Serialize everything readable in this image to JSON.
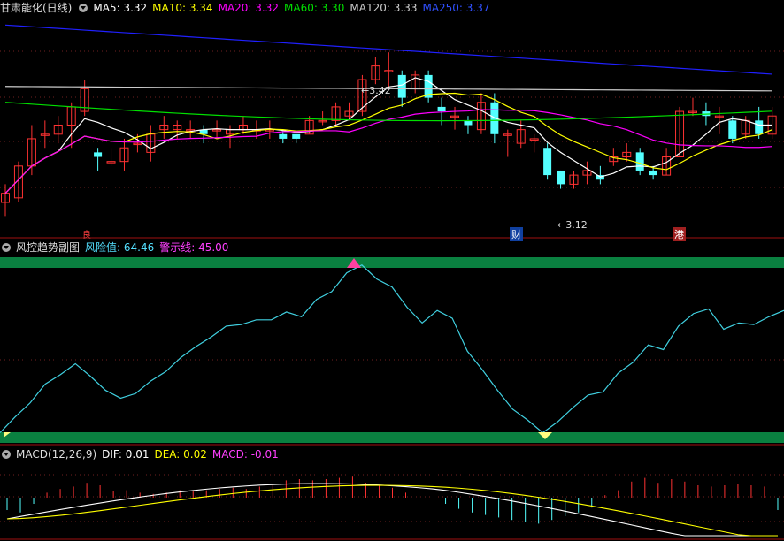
{
  "main_header": {
    "title": "甘肃能化(日线)",
    "ma5": "MA5: 3.32",
    "ma10": "MA10: 3.34",
    "ma20": "MA20: 3.32",
    "ma60": "MA60: 3.30",
    "ma120": "MA120: 3.33",
    "ma250": "MA250: 3.37"
  },
  "annotations": {
    "high": "3.42",
    "low": "3.12",
    "mark_left": "良",
    "mark_cai": "财",
    "mark_gang": "港"
  },
  "risk_header": {
    "title": "风控趋势副图",
    "risk_value": "风险值: 64.46",
    "warn_line": "警示线: 45.00"
  },
  "macd_header": {
    "title": "MACD(12,26,9)",
    "dif": "DIF: 0.01",
    "dea": "DEA: 0.02",
    "macd": "MACD: -0.01"
  },
  "colors": {
    "up": "#ff3232",
    "down": "#54ffff",
    "ma5": "#ffffff",
    "ma10": "#ffff00",
    "ma20": "#ff00ff",
    "ma60": "#00e000",
    "ma120": "#cccccc",
    "ma250": "#2020ff",
    "risk_line": "#40d0e0",
    "band": "#0a8040"
  },
  "chart_data": [
    {
      "type": "candlestick",
      "title": "甘肃能化(日线)",
      "ylim": [
        3.02,
        3.5
      ],
      "candles": [
        [
          3.09,
          3.11,
          3.13,
          3.06
        ],
        [
          3.1,
          3.17,
          3.18,
          3.09
        ],
        [
          3.17,
          3.23,
          3.26,
          3.15
        ],
        [
          3.24,
          3.24,
          3.27,
          3.21
        ],
        [
          3.24,
          3.26,
          3.28,
          3.22
        ],
        [
          3.26,
          3.3,
          3.31,
          3.21
        ],
        [
          3.29,
          3.34,
          3.36,
          3.28
        ],
        [
          3.2,
          3.19,
          3.21,
          3.16
        ],
        [
          3.18,
          3.18,
          3.21,
          3.17
        ],
        [
          3.18,
          3.21,
          3.23,
          3.16
        ],
        [
          3.22,
          3.22,
          3.24,
          3.2
        ],
        [
          3.2,
          3.24,
          3.26,
          3.18
        ],
        [
          3.25,
          3.26,
          3.28,
          3.23
        ],
        [
          3.25,
          3.26,
          3.27,
          3.23
        ],
        [
          3.25,
          3.25,
          3.27,
          3.23
        ],
        [
          3.25,
          3.24,
          3.26,
          3.22
        ],
        [
          3.25,
          3.25,
          3.27,
          3.23
        ],
        [
          3.24,
          3.25,
          3.26,
          3.21
        ],
        [
          3.25,
          3.26,
          3.28,
          3.24
        ],
        [
          3.25,
          3.25,
          3.27,
          3.23
        ],
        [
          3.25,
          3.25,
          3.27,
          3.23
        ],
        [
          3.24,
          3.23,
          3.25,
          3.22
        ],
        [
          3.24,
          3.23,
          3.24,
          3.22
        ],
        [
          3.24,
          3.27,
          3.28,
          3.24
        ],
        [
          3.27,
          3.27,
          3.29,
          3.26
        ],
        [
          3.27,
          3.3,
          3.31,
          3.26
        ],
        [
          3.28,
          3.29,
          3.31,
          3.27
        ],
        [
          3.29,
          3.36,
          3.37,
          3.28
        ],
        [
          3.36,
          3.39,
          3.41,
          3.35
        ],
        [
          3.38,
          3.38,
          3.42,
          3.34
        ],
        [
          3.37,
          3.32,
          3.38,
          3.3
        ],
        [
          3.34,
          3.37,
          3.38,
          3.33
        ],
        [
          3.37,
          3.32,
          3.38,
          3.31
        ],
        [
          3.3,
          3.29,
          3.32,
          3.26
        ],
        [
          3.28,
          3.28,
          3.3,
          3.25
        ],
        [
          3.27,
          3.26,
          3.28,
          3.24
        ],
        [
          3.25,
          3.31,
          3.33,
          3.24
        ],
        [
          3.31,
          3.24,
          3.33,
          3.22
        ],
        [
          3.24,
          3.24,
          3.25,
          3.19
        ],
        [
          3.22,
          3.25,
          3.27,
          3.21
        ],
        [
          3.23,
          3.23,
          3.24,
          3.2
        ],
        [
          3.21,
          3.15,
          3.22,
          3.14
        ],
        [
          3.16,
          3.13,
          3.16,
          3.12
        ],
        [
          3.13,
          3.15,
          3.16,
          3.12
        ],
        [
          3.15,
          3.16,
          3.18,
          3.13
        ],
        [
          3.15,
          3.14,
          3.17,
          3.13
        ],
        [
          3.18,
          3.19,
          3.21,
          3.17
        ],
        [
          3.19,
          3.2,
          3.22,
          3.18
        ],
        [
          3.2,
          3.16,
          3.21,
          3.15
        ],
        [
          3.16,
          3.15,
          3.17,
          3.14
        ],
        [
          3.15,
          3.19,
          3.21,
          3.15
        ],
        [
          3.19,
          3.29,
          3.3,
          3.19
        ],
        [
          3.29,
          3.29,
          3.32,
          3.28
        ],
        [
          3.29,
          3.28,
          3.31,
          3.26
        ],
        [
          3.28,
          3.28,
          3.3,
          3.24
        ],
        [
          3.27,
          3.23,
          3.28,
          3.22
        ],
        [
          3.24,
          3.27,
          3.28,
          3.23
        ],
        [
          3.27,
          3.24,
          3.3,
          3.23
        ],
        [
          3.24,
          3.28,
          3.3,
          3.23
        ]
      ]
    },
    {
      "type": "line",
      "title": "风控趋势副图",
      "ylim": [
        0,
        100
      ],
      "warn_line": 45,
      "values": [
        2,
        12,
        21,
        33,
        39,
        46,
        38,
        29,
        24,
        27,
        35,
        41,
        50,
        57,
        63,
        70,
        71,
        74,
        74,
        79,
        76,
        87,
        92,
        104,
        109,
        100,
        95,
        82,
        72,
        80,
        75,
        54,
        42,
        29,
        17,
        10,
        2,
        9,
        18,
        26,
        28,
        40,
        47,
        58,
        55,
        70,
        78,
        81,
        68,
        72,
        71,
        76,
        80
      ]
    },
    {
      "type": "macd",
      "title": "MACD(12,26,9)",
      "hist": [
        -0.01,
        -0.012,
        -0.005,
        0.004,
        0.007,
        0.009,
        0.012,
        0.01,
        0.005,
        0.006,
        0.004,
        0.003,
        0.004,
        0.006,
        0.005,
        0.006,
        0.007,
        0.008,
        0.007,
        0.009,
        0.01,
        0.014,
        0.015,
        0.014,
        0.015,
        0.016,
        0.017,
        0.012,
        0.01,
        0.008,
        0.004,
        0.002,
        0.0,
        -0.005,
        -0.009,
        -0.012,
        -0.014,
        -0.016,
        -0.018,
        -0.02,
        -0.021,
        -0.018,
        -0.015,
        -0.012,
        -0.008,
        0.002,
        0.006,
        0.013,
        0.016,
        0.012,
        0.015,
        0.013,
        0.01,
        0.009,
        0.01,
        0.011,
        0.01,
        0.009,
        -0.01
      ]
    }
  ]
}
